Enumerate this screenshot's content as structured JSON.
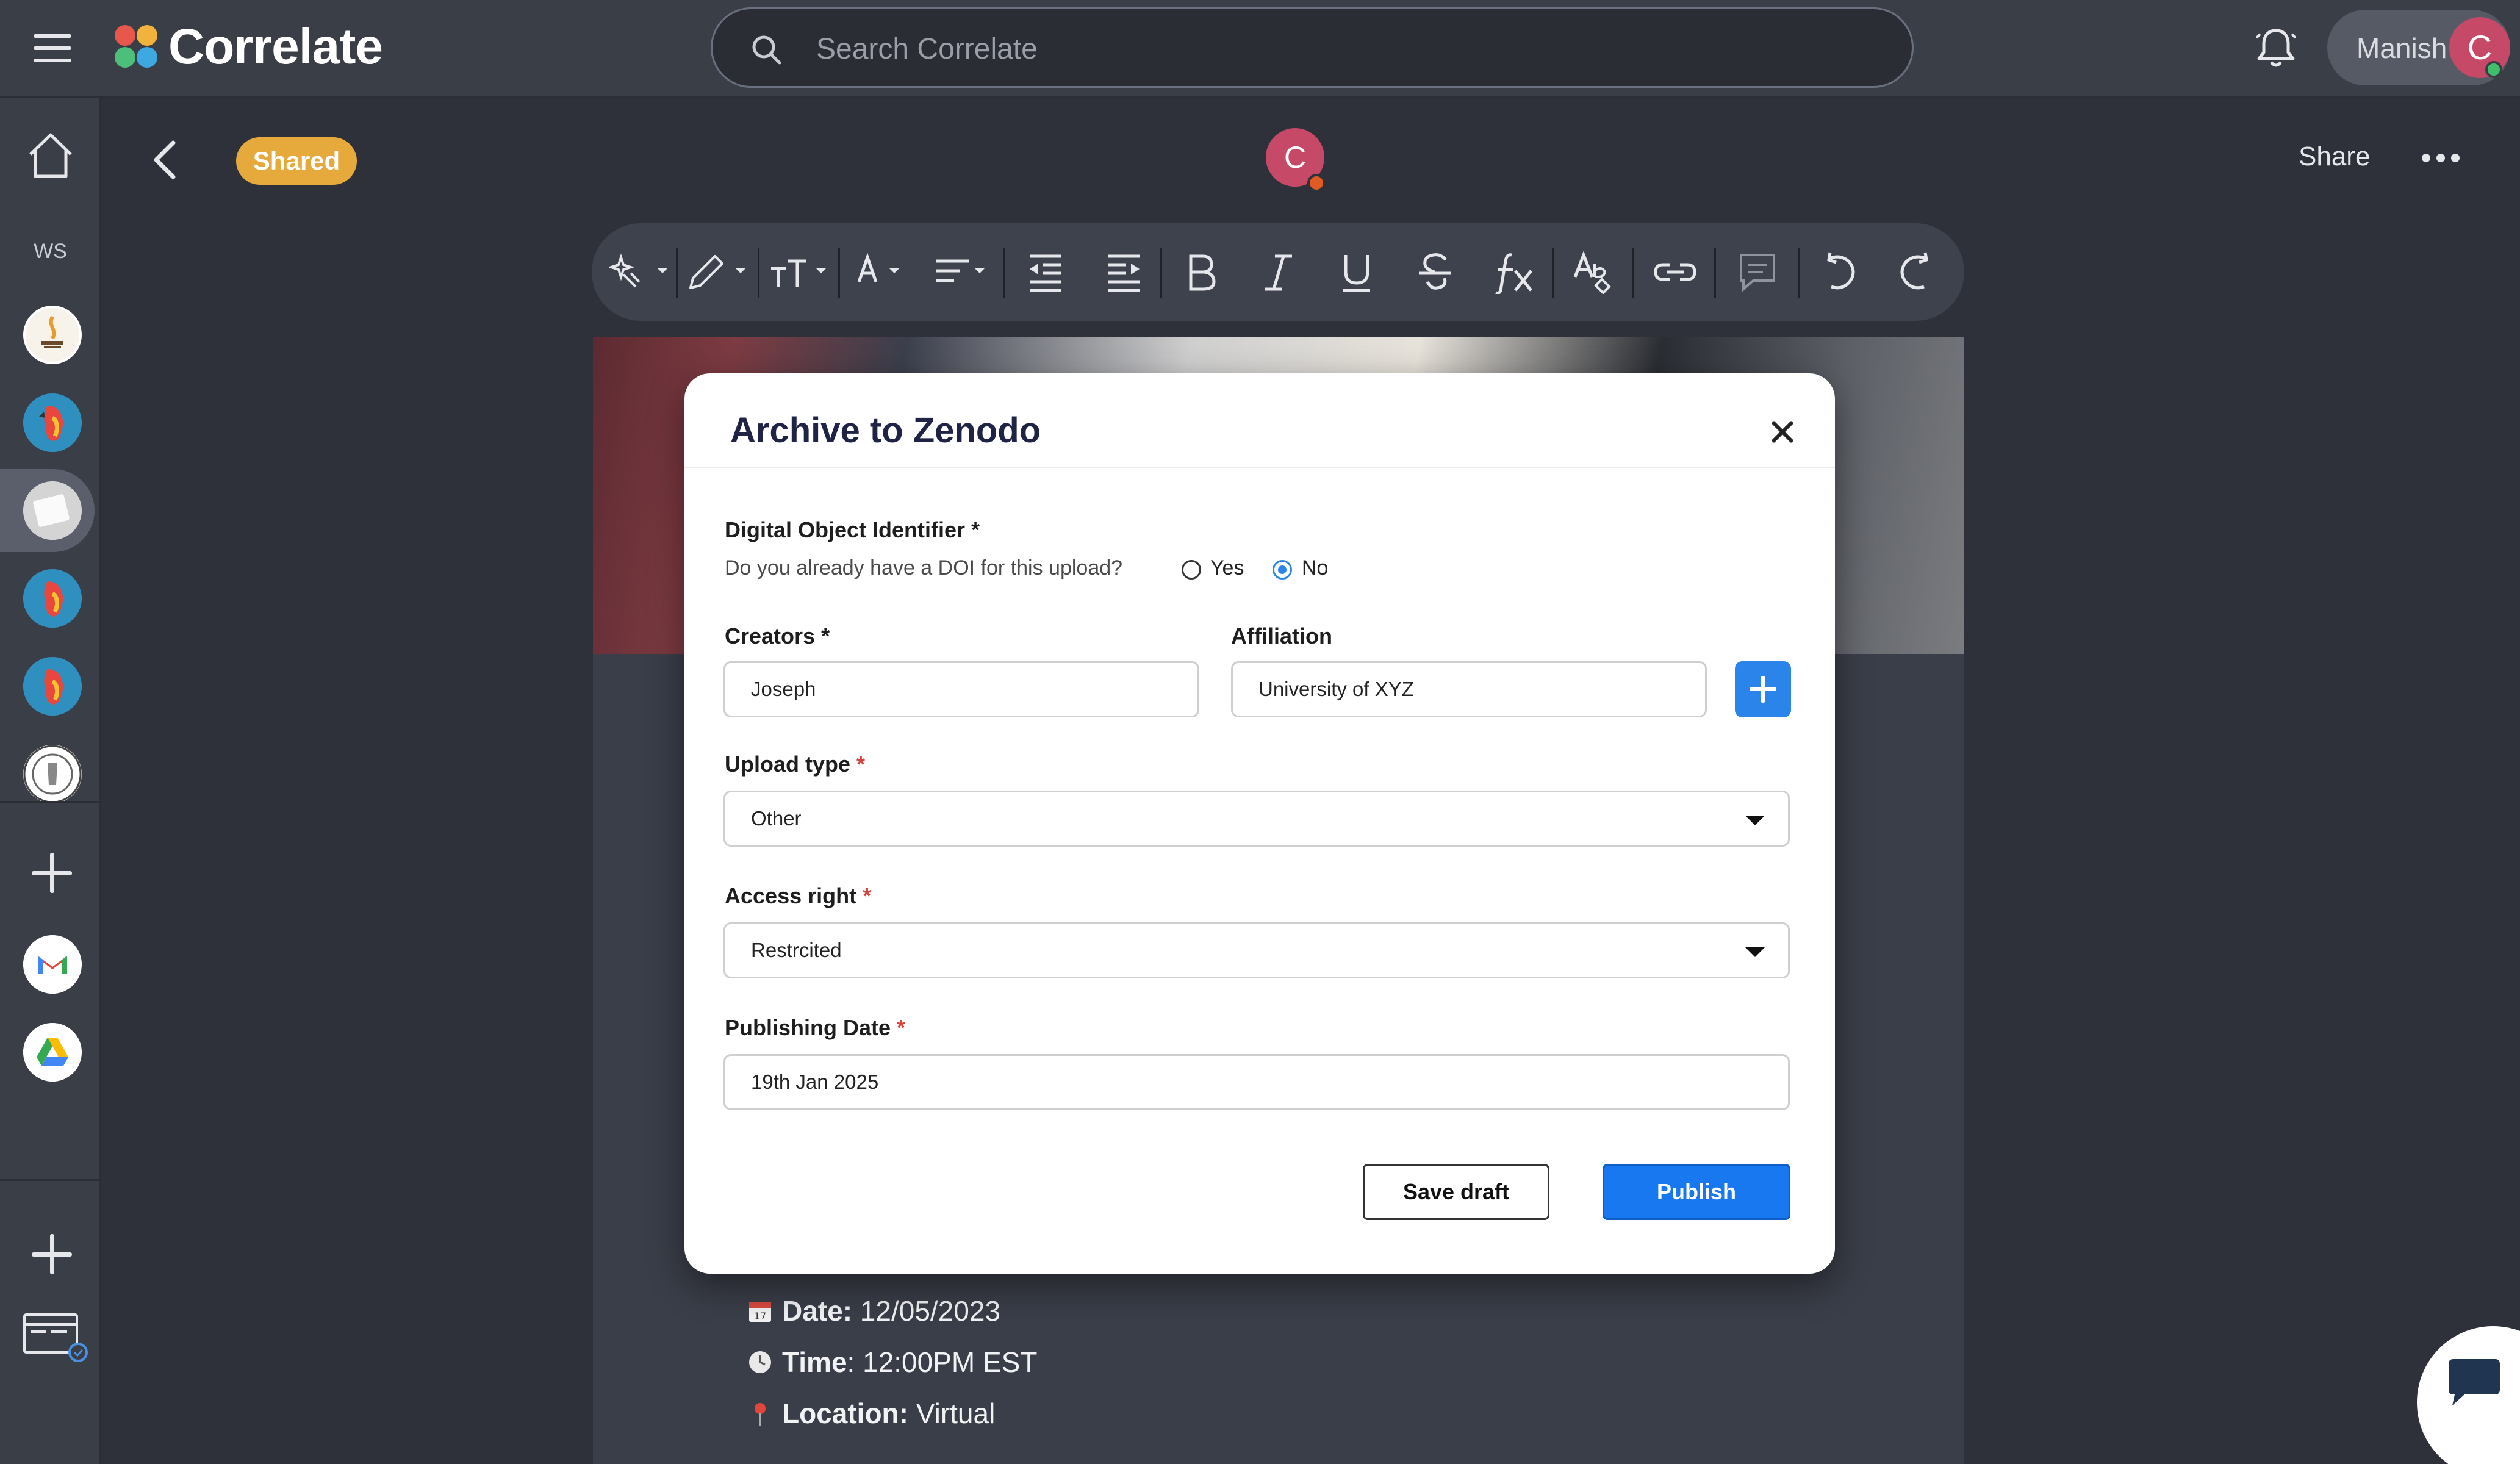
{
  "app": {
    "name": "Correlate"
  },
  "search": {
    "placeholder": "Search Correlate"
  },
  "user": {
    "name": "Manish",
    "initial": "C"
  },
  "rail": {
    "ws_label": "WS"
  },
  "doc": {
    "status_badge": "Shared",
    "collaborator_initial": "C",
    "share_label": "Share",
    "lines": [
      {
        "label": "Date:",
        "value": " 12/05/2023"
      },
      {
        "label": "Time",
        "value": ": 12:00PM EST"
      },
      {
        "label": "Location:",
        "value": " Virtual"
      }
    ]
  },
  "modal": {
    "title": "Archive to Zenodo",
    "doi": {
      "label": "Digital Object Identifier *",
      "question": "Do you already have a DOI for this upload?",
      "options": [
        "Yes",
        "No"
      ],
      "selected": "No"
    },
    "creators": {
      "label": "Creators *",
      "value": "Joseph"
    },
    "affiliation": {
      "label": "Affiliation",
      "value": "University of XYZ"
    },
    "upload_type": {
      "label": "Upload type",
      "required_mark": "*",
      "value": "Other"
    },
    "access_right": {
      "label": "Access right",
      "required_mark": "*",
      "value": "Restrcited"
    },
    "publishing_date": {
      "label": "Publishing Date",
      "required_mark": "*",
      "value": "19th Jan 2025"
    },
    "save_draft_label": "Save draft",
    "publish_label": "Publish"
  },
  "colors": {
    "accent_blue": "#1878f0",
    "shared_badge": "#e6a93c",
    "avatar": "#c64a67"
  },
  "icons": [
    "menu-icon",
    "search-icon",
    "bell-icon",
    "home-icon",
    "back-icon",
    "more-icon",
    "close-icon",
    "plus-icon",
    "chevron-down-icon",
    "chat-icon"
  ]
}
